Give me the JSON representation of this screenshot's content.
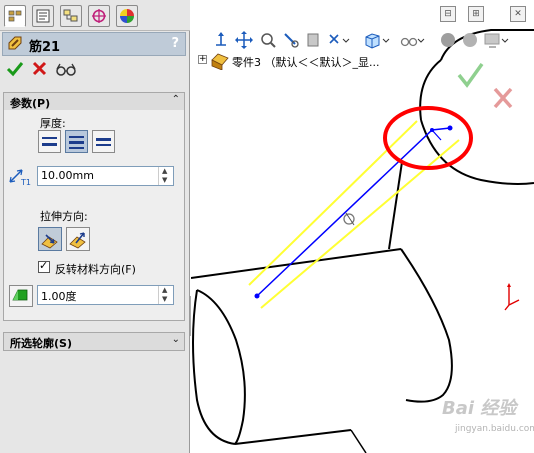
{
  "feature": {
    "title": "筋21",
    "help_label": "?"
  },
  "tabs": [
    {
      "icon": "feature-manager-icon",
      "active": true
    },
    {
      "icon": "property-manager-icon",
      "active": false
    },
    {
      "icon": "configuration-manager-icon",
      "active": false
    },
    {
      "icon": "dimxpert-icon",
      "active": false
    },
    {
      "icon": "display-manager-icon",
      "active": false
    }
  ],
  "actions": {
    "ok_icon": "checkmark-icon",
    "cancel_icon": "x-icon",
    "preview_icon": "glasses-icon"
  },
  "params_group": {
    "label": "参数(P)",
    "thickness_label": "厚度:",
    "thickness_value": "10.00mm",
    "thickness_dim_label": "T1",
    "extrude_dir_label": "拉伸方向:",
    "flip_label": "反转材料方向(F)",
    "flip_checked": true,
    "draft_value": "1.00度"
  },
  "contours_group": {
    "label": "所选轮廓(S)"
  },
  "viewport": {
    "tree_text": "零件3 （默认＜＜默认＞_显...",
    "tree_expander": "+",
    "confirm_colors": {
      "ok": "#8fd08f",
      "cancel": "#e59a9a"
    },
    "highlight_color": "#ff0000",
    "rib_line_color": "#0000ff",
    "preview_color": "#ffff33"
  },
  "watermark": {
    "brand": "Bai 经验",
    "site": "jingyan.baidu.com"
  }
}
